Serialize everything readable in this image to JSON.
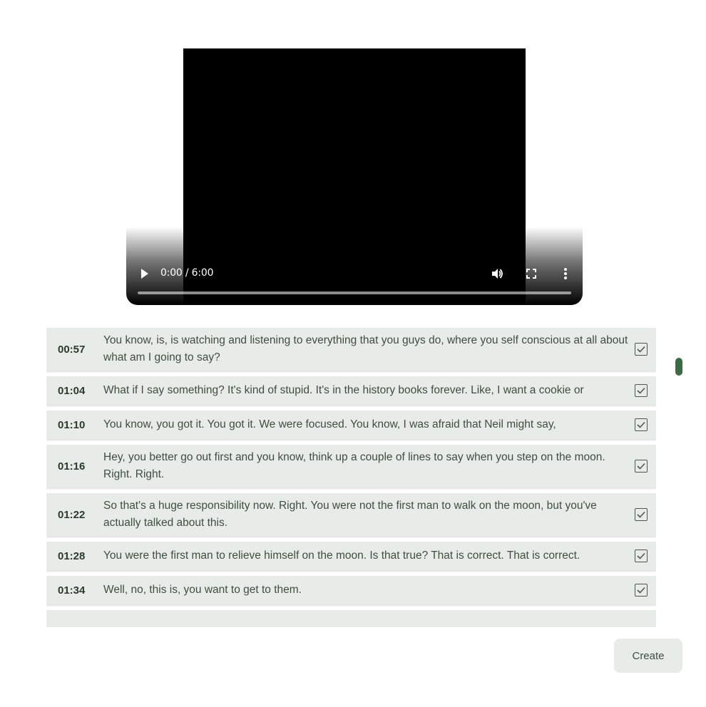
{
  "player": {
    "time_display": "0:00 / 6:00",
    "progress": 0
  },
  "segments": [
    {
      "time": "00:57",
      "text": "You know, is, is watching and listening to everything that you guys do, where you self conscious at all about what am I going to say?",
      "checked": true
    },
    {
      "time": "01:04",
      "text": "What if I say something? It's kind of stupid. It's in the history books forever. Like, I want a cookie or",
      "checked": true
    },
    {
      "time": "01:10",
      "text": "You know, you got it. You got it. We were focused. You know, I was afraid that Neil might say,",
      "checked": true
    },
    {
      "time": "01:16",
      "text": "Hey, you better go out first and you know, think up a couple of lines to say when you step on the moon. Right. Right.",
      "checked": true
    },
    {
      "time": "01:22",
      "text": "So that's a huge responsibility now. Right. You were not the first man to walk on the moon, but you've actually talked about this.",
      "checked": true
    },
    {
      "time": "01:28",
      "text": "You were the first man to relieve himself on the moon. Is that true? That is correct. That is correct.",
      "checked": true
    },
    {
      "time": "01:34",
      "text": "Well, no, this is, you want to get to them.",
      "checked": true
    }
  ],
  "actions": {
    "create_label": "Create"
  },
  "colors": {
    "row_bg": "#e8ece8",
    "accent": "#3d6a47"
  }
}
